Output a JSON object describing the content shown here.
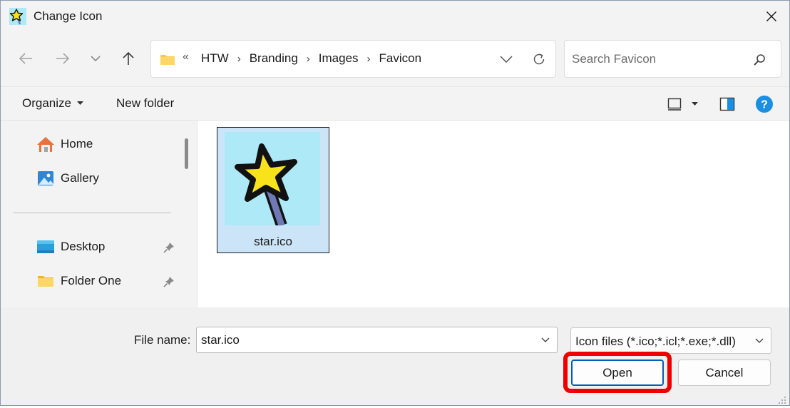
{
  "window": {
    "title": "Change Icon"
  },
  "address_bar": {
    "overflow": "«",
    "crumbs": [
      "HTW",
      "Branding",
      "Images",
      "Favicon"
    ]
  },
  "search": {
    "placeholder": "Search Favicon"
  },
  "command_bar": {
    "organize_label": "Organize",
    "new_folder_label": "New folder"
  },
  "nav_pane": {
    "items": [
      {
        "label": "Home",
        "icon": "home-icon"
      },
      {
        "label": "Gallery",
        "icon": "gallery-icon"
      },
      {
        "label": "Desktop",
        "icon": "desktop-icon",
        "pinned": true
      },
      {
        "label": "Folder One",
        "icon": "folder-icon",
        "pinned": true
      }
    ]
  },
  "files": [
    {
      "name": "star.ico",
      "selected": true
    }
  ],
  "footer": {
    "file_name_label": "File name:",
    "file_name_value": "star.ico",
    "filter_value": "Icon files (*.ico;*.icl;*.exe;*.dll)",
    "open_label": "Open",
    "cancel_label": "Cancel"
  },
  "colors": {
    "accent": "#005fb8",
    "selection": "#cce4f7",
    "highlight": "#ef0000",
    "folder": "#f8c84a",
    "help": "#1a8fe3"
  }
}
